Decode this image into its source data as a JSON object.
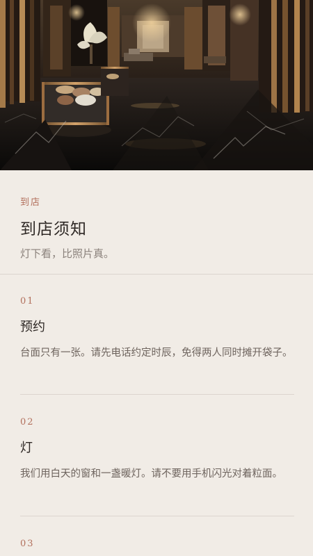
{
  "hero": {
    "image_name": "luxury-store-interior-image"
  },
  "header": {
    "kicker": "到店",
    "title": "到店须知",
    "subtitle": "灯下看，比照片真。"
  },
  "notices": [
    {
      "number": "01",
      "title": "预约",
      "text": "台面只有一张。请先电话约定时辰，免得两人同时摊开袋子。"
    },
    {
      "number": "02",
      "title": "灯",
      "text": "我们用白天的窗和一盏暖灯。请不要用手机闪光对着粒面。"
    },
    {
      "number": "03",
      "title": "",
      "text": ""
    }
  ],
  "colors": {
    "accent": "#b26f5c",
    "background": "#f1ece6",
    "heading": "#2f2926",
    "body_text": "#6e645e",
    "divider": "#dcd5cf"
  }
}
